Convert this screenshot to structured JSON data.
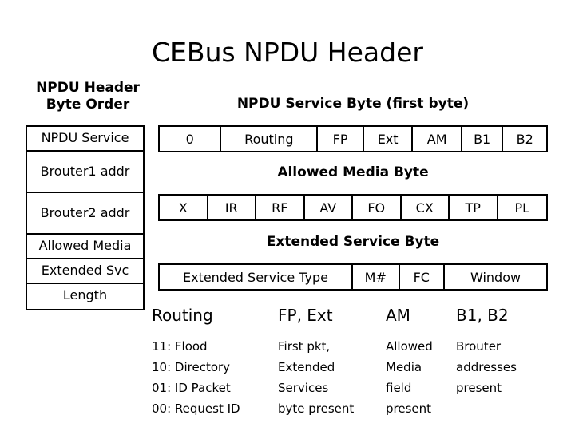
{
  "title": "CEBus NPDU Header",
  "byte_order": {
    "label": "NPDU Header\nByte Order",
    "label_line1": "NPDU Header",
    "label_line2": "Byte Order",
    "cells": [
      "NPDU Service",
      "Brouter1 addr",
      "Brouter2 addr",
      "Allowed Media",
      "Extended Svc",
      "Length"
    ]
  },
  "service_byte": {
    "title": "NPDU Service Byte (first byte)",
    "fields": [
      "0",
      "Routing",
      "FP",
      "Ext",
      "AM",
      "B1",
      "B2"
    ]
  },
  "allowed_media_byte": {
    "title": "Allowed Media Byte",
    "fields": [
      "X",
      "IR",
      "RF",
      "AV",
      "FO",
      "CX",
      "TP",
      "PL"
    ]
  },
  "extended_service_byte": {
    "title": "Extended Service Byte",
    "fields": [
      "Extended Service Type",
      "M#",
      "FC",
      "Window"
    ]
  },
  "legend": [
    {
      "head": "Routing",
      "lines": [
        "11: Flood",
        "10: Directory",
        "01: ID Packet",
        "00: Request ID"
      ]
    },
    {
      "head": "FP, Ext",
      "lines": [
        "First pkt,",
        "Extended",
        "Services",
        "byte present"
      ]
    },
    {
      "head": "AM",
      "lines": [
        "Allowed",
        "Media",
        "field",
        "present"
      ]
    },
    {
      "head": "B1, B2",
      "lines": [
        "Brouter",
        "addresses",
        "present",
        ""
      ]
    }
  ]
}
